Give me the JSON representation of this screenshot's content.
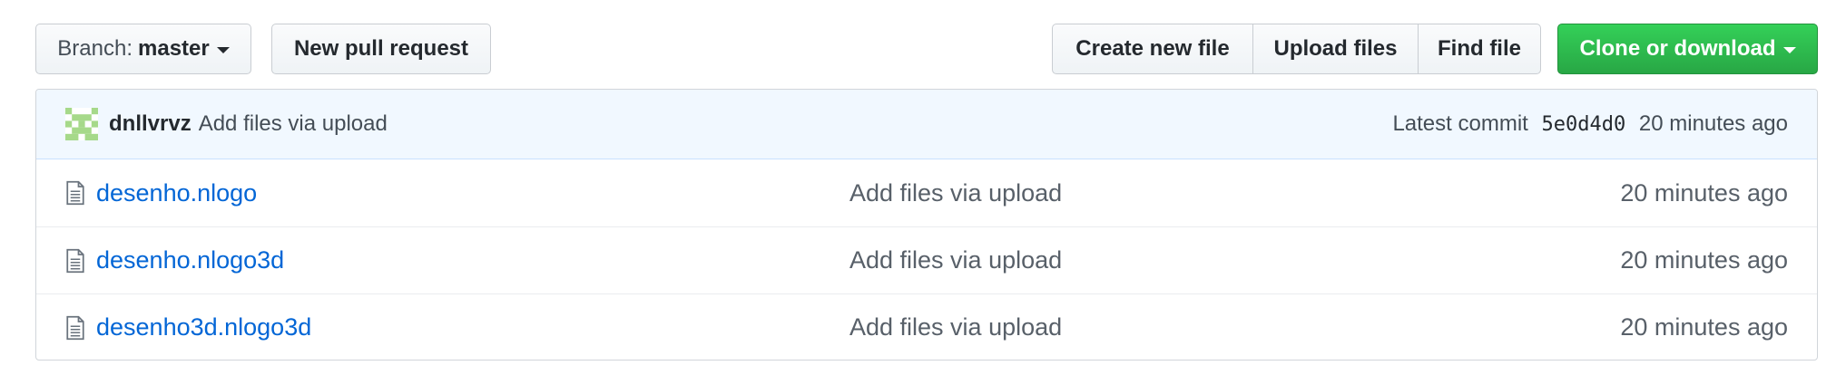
{
  "toolbar": {
    "branch_prefix": "Branch:",
    "branch_name": "master",
    "new_pull_request": "New pull request",
    "create_new_file": "Create new file",
    "upload_files": "Upload files",
    "find_file": "Find file",
    "clone_or_download": "Clone or download"
  },
  "commit": {
    "author": "dnllvrvz",
    "message": "Add files via upload",
    "latest_label": "Latest commit",
    "sha": "5e0d4d0",
    "age": "20 minutes ago"
  },
  "files": [
    {
      "name": "desenho.nlogo",
      "message": "Add files via upload",
      "age": "20 minutes ago",
      "icon": "file-icon"
    },
    {
      "name": "desenho.nlogo3d",
      "message": "Add files via upload",
      "age": "20 minutes ago",
      "icon": "file-icon"
    },
    {
      "name": "desenho3d.nlogo3d",
      "message": "Add files via upload",
      "age": "20 minutes ago",
      "icon": "file-icon"
    }
  ],
  "colors": {
    "link": "#0366d6",
    "primary_button": "#28a745",
    "commit_bar": "#f1f8ff"
  }
}
